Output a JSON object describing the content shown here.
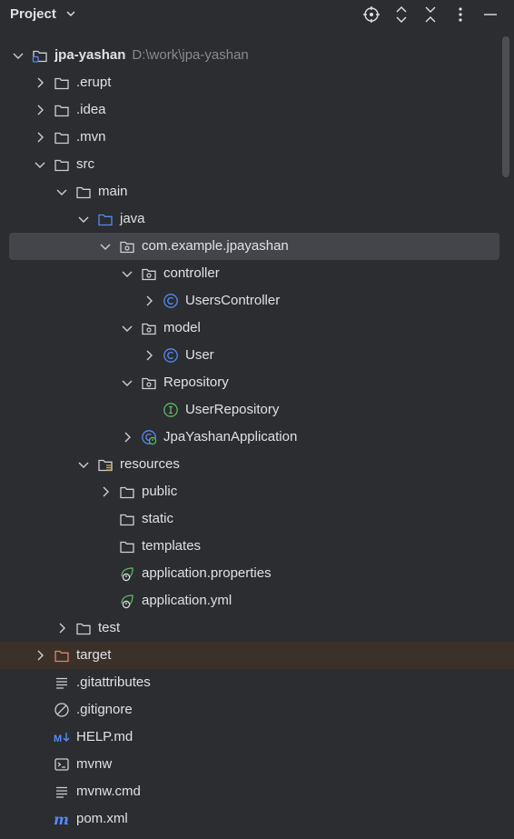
{
  "header": {
    "title": "Project",
    "icons": [
      "chevron-down-icon",
      "locate-icon",
      "expand-all-icon",
      "collapse-all-icon",
      "more-icon",
      "minimize-icon"
    ]
  },
  "tree": [
    {
      "label": "jpa-yashan",
      "path": "D:\\work\\jpa-yashan",
      "depth": 0,
      "arrow": "down",
      "icon": "module-folder",
      "bold": true
    },
    {
      "label": ".erupt",
      "depth": 1,
      "arrow": "right",
      "icon": "folder"
    },
    {
      "label": ".idea",
      "depth": 1,
      "arrow": "right",
      "icon": "folder"
    },
    {
      "label": ".mvn",
      "depth": 1,
      "arrow": "right",
      "icon": "folder"
    },
    {
      "label": "src",
      "depth": 1,
      "arrow": "down",
      "icon": "folder"
    },
    {
      "label": "main",
      "depth": 2,
      "arrow": "down",
      "icon": "folder"
    },
    {
      "label": "java",
      "depth": 3,
      "arrow": "down",
      "icon": "source-folder"
    },
    {
      "label": "com.example.jpayashan",
      "depth": 4,
      "arrow": "down",
      "icon": "package",
      "selected": true
    },
    {
      "label": "controller",
      "depth": 5,
      "arrow": "down",
      "icon": "package"
    },
    {
      "label": "UsersController",
      "depth": 6,
      "arrow": "right",
      "icon": "class"
    },
    {
      "label": "model",
      "depth": 5,
      "arrow": "down",
      "icon": "package"
    },
    {
      "label": "User",
      "depth": 6,
      "arrow": "right",
      "icon": "class"
    },
    {
      "label": "Repository",
      "depth": 5,
      "arrow": "down",
      "icon": "package"
    },
    {
      "label": "UserRepository",
      "depth": 6,
      "arrow": "none",
      "icon": "interface"
    },
    {
      "label": "JpaYashanApplication",
      "depth": 5,
      "arrow": "right",
      "icon": "spring-class"
    },
    {
      "label": "resources",
      "depth": 3,
      "arrow": "down",
      "icon": "resources-folder"
    },
    {
      "label": "public",
      "depth": 4,
      "arrow": "right",
      "icon": "folder"
    },
    {
      "label": "static",
      "depth": 4,
      "arrow": "none",
      "icon": "folder"
    },
    {
      "label": "templates",
      "depth": 4,
      "arrow": "none",
      "icon": "folder"
    },
    {
      "label": "application.properties",
      "depth": 4,
      "arrow": "none",
      "icon": "spring-config"
    },
    {
      "label": "application.yml",
      "depth": 4,
      "arrow": "none",
      "icon": "spring-config"
    },
    {
      "label": "test",
      "depth": 2,
      "arrow": "right",
      "icon": "folder"
    },
    {
      "label": "target",
      "depth": 1,
      "arrow": "right",
      "icon": "excluded-folder",
      "excluded": true
    },
    {
      "label": ".gitattributes",
      "depth": 1,
      "arrow": "none",
      "icon": "text-file"
    },
    {
      "label": ".gitignore",
      "depth": 1,
      "arrow": "none",
      "icon": "ignore-file"
    },
    {
      "label": "HELP.md",
      "depth": 1,
      "arrow": "none",
      "icon": "markdown-file"
    },
    {
      "label": "mvnw",
      "depth": 1,
      "arrow": "none",
      "icon": "shell-file"
    },
    {
      "label": "mvnw.cmd",
      "depth": 1,
      "arrow": "none",
      "icon": "text-file"
    },
    {
      "label": "pom.xml",
      "depth": 1,
      "arrow": "none",
      "icon": "maven-file"
    }
  ],
  "colors": {
    "background": "#2b2d30",
    "selection": "#43454a",
    "excluded_row": "#3b3129",
    "class_icon": "#548af7",
    "interface_icon": "#5fb865",
    "spring_icon": "#5fb865",
    "excluded_folder": "#e0836a"
  }
}
